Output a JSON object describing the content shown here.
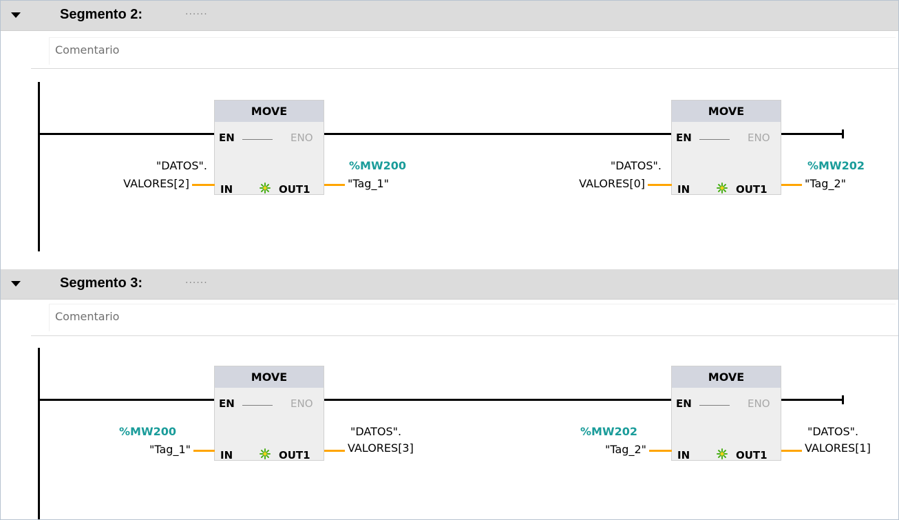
{
  "segments": [
    {
      "title": "Segmento 2:",
      "dots": "......",
      "comment": "Comentario",
      "blocks": [
        {
          "title": "MOVE",
          "en": "EN",
          "eno": "ENO",
          "in_pin": "IN",
          "out_pin": "OUT1",
          "in_line1": "\"DATOS\".",
          "in_line2": "VALORES[2]",
          "out_addr": "%MW200",
          "out_tag": "\"Tag_1\""
        },
        {
          "title": "MOVE",
          "en": "EN",
          "eno": "ENO",
          "in_pin": "IN",
          "out_pin": "OUT1",
          "in_line1": "\"DATOS\".",
          "in_line2": "VALORES[0]",
          "out_addr": "%MW202",
          "out_tag": "\"Tag_2\""
        }
      ]
    },
    {
      "title": "Segmento 3:",
      "dots": "......",
      "comment": "Comentario",
      "blocks": [
        {
          "title": "MOVE",
          "en": "EN",
          "eno": "ENO",
          "in_pin": "IN",
          "out_pin": "OUT1",
          "in_addr": "%MW200",
          "in_tag": "\"Tag_1\"",
          "out_line1": "\"DATOS\".",
          "out_line2": "VALORES[3]"
        },
        {
          "title": "MOVE",
          "en": "EN",
          "eno": "ENO",
          "in_pin": "IN",
          "out_pin": "OUT1",
          "in_addr": "%MW202",
          "in_tag": "\"Tag_2\"",
          "out_line1": "\"DATOS\".",
          "out_line2": "VALORES[1]"
        }
      ]
    }
  ],
  "colors": {
    "address": "#1a9c9a",
    "wire": "#ffa500",
    "header_bg": "#dcdcdc",
    "block_title_bg": "#d3d6df"
  },
  "icons": {
    "collapse": "triangle-down-icon",
    "out_marker": "asterisk-spark-icon"
  }
}
